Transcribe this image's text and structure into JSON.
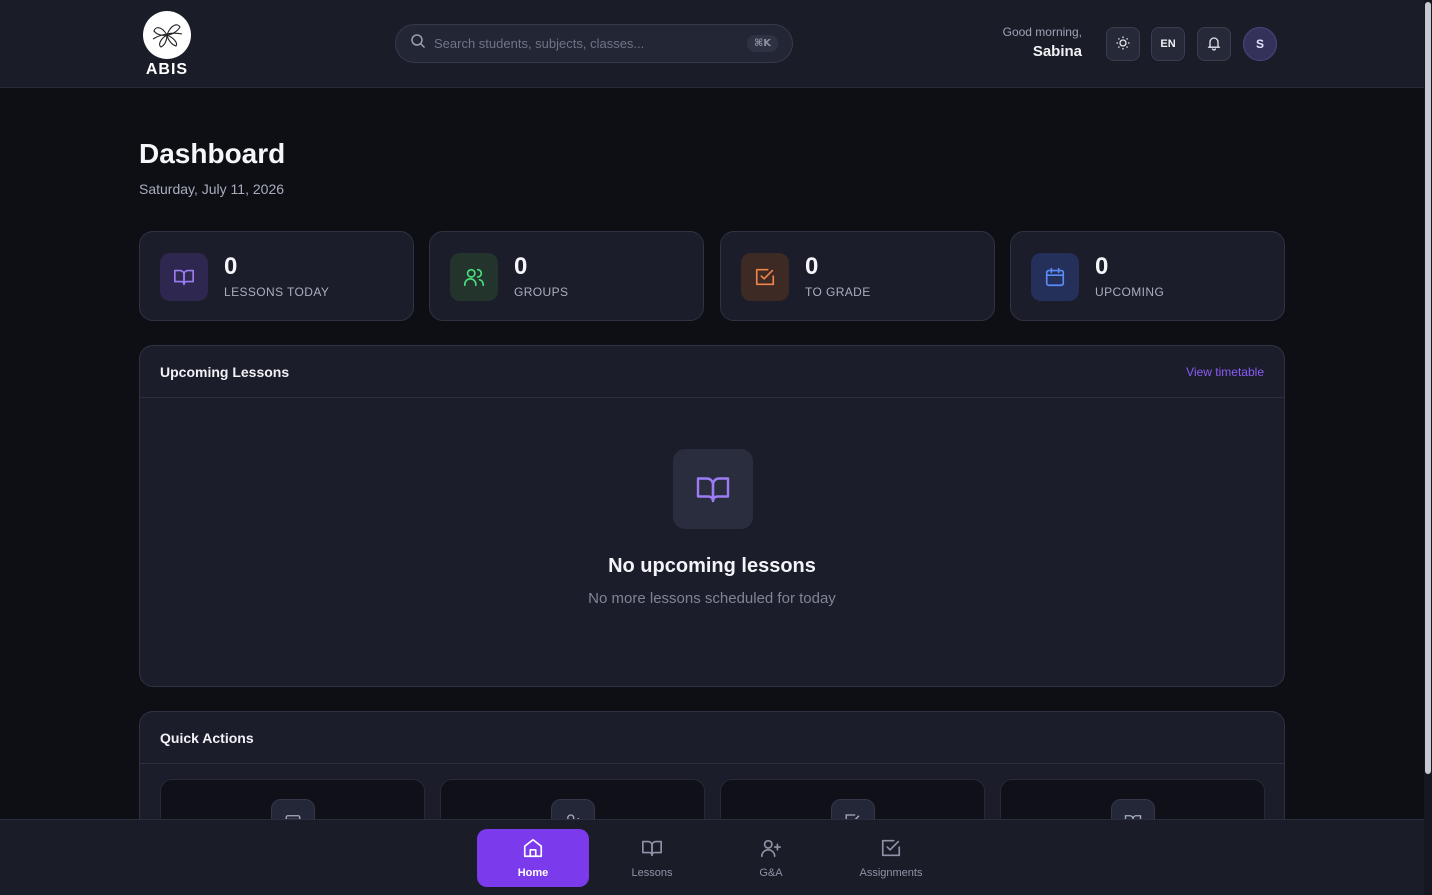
{
  "brand": {
    "name": "ABIS"
  },
  "search": {
    "placeholder": "Search students, subjects, classes...",
    "shortcut": "⌘K"
  },
  "header": {
    "greeting": "Good morning,",
    "user_name": "Sabina",
    "language": "EN",
    "avatar_initial": "S",
    "icons": [
      "sun-icon",
      "bell-icon"
    ]
  },
  "page": {
    "title": "Dashboard",
    "date": "Saturday, July 11, 2026"
  },
  "stats": [
    {
      "value": "0",
      "label": "LESSONS TODAY",
      "icon": "book-icon",
      "color": "#9b7cf4",
      "bg": "#2e2850"
    },
    {
      "value": "0",
      "label": "GROUPS",
      "icon": "users-icon",
      "color": "#4ade80",
      "bg": "#22342c"
    },
    {
      "value": "0",
      "label": "TO GRADE",
      "icon": "check-square-icon",
      "color": "#f0834a",
      "bg": "#3d2a25"
    },
    {
      "value": "0",
      "label": "UPCOMING",
      "icon": "calendar-icon",
      "color": "#5b8cf5",
      "bg": "#25305a"
    }
  ],
  "upcoming": {
    "title": "Upcoming Lessons",
    "link": "View timetable",
    "empty_title": "No upcoming lessons",
    "empty_subtitle": "No more lessons scheduled for today"
  },
  "quick_actions": {
    "title": "Quick Actions",
    "tiles": [
      "calendar-icon",
      "user-plus-icon",
      "check-square-icon",
      "book-icon"
    ]
  },
  "nav": {
    "items": [
      {
        "label": "Home",
        "icon": "home-icon",
        "active": true
      },
      {
        "label": "Lessons",
        "icon": "book-icon",
        "active": false
      },
      {
        "label": "G&A",
        "icon": "user-plus-icon",
        "active": false
      },
      {
        "label": "Assignments",
        "icon": "check-square-icon",
        "active": false
      }
    ]
  },
  "colors": {
    "accent": "#7c3aed",
    "background": "#0e0f15",
    "surface": "#1b1d2a"
  }
}
